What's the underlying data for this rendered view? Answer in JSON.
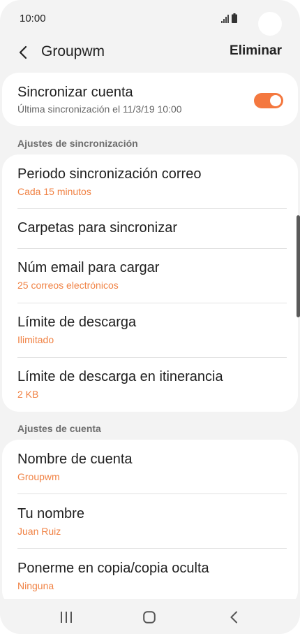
{
  "status_bar": {
    "time": "10:00",
    "signal_icon": "signal-icon",
    "battery_icon": "battery-icon"
  },
  "app_bar": {
    "title": "Groupwm",
    "delete_label": "Eliminar",
    "back_icon": "back-arrow-icon"
  },
  "sync_account": {
    "title": "Sincronizar cuenta",
    "subtitle": "Última sincronización el 11/3/19  10:00",
    "toggle_on": true,
    "accent_color": "#f4783f"
  },
  "sync_settings": {
    "section_label": "Ajustes de sincronización",
    "items": [
      {
        "title": "Periodo sincronización correo",
        "subtitle": "Cada 15 minutos"
      },
      {
        "title": "Carpetas para sincronizar",
        "subtitle": ""
      },
      {
        "title": "Núm email para cargar",
        "subtitle": "25 correos electrónicos"
      },
      {
        "title": "Límite de descarga",
        "subtitle": "Ilimitado"
      },
      {
        "title": "Límite de descarga en itinerancia",
        "subtitle": "2 KB"
      }
    ]
  },
  "account_settings": {
    "section_label": "Ajustes de cuenta",
    "items": [
      {
        "title": "Nombre de cuenta",
        "subtitle": "Groupwm"
      },
      {
        "title": "Tu nombre",
        "subtitle": "Juan Ruiz"
      },
      {
        "title": "Ponerme en copia/copia oculta",
        "subtitle": "Ninguna"
      }
    ]
  },
  "nav_bar": {
    "recent_icon": "recent-apps-icon",
    "home_icon": "home-icon",
    "back_icon": "nav-back-icon"
  },
  "colors": {
    "accent": "#f08244",
    "background": "#f3f3f3",
    "card": "#ffffff"
  }
}
